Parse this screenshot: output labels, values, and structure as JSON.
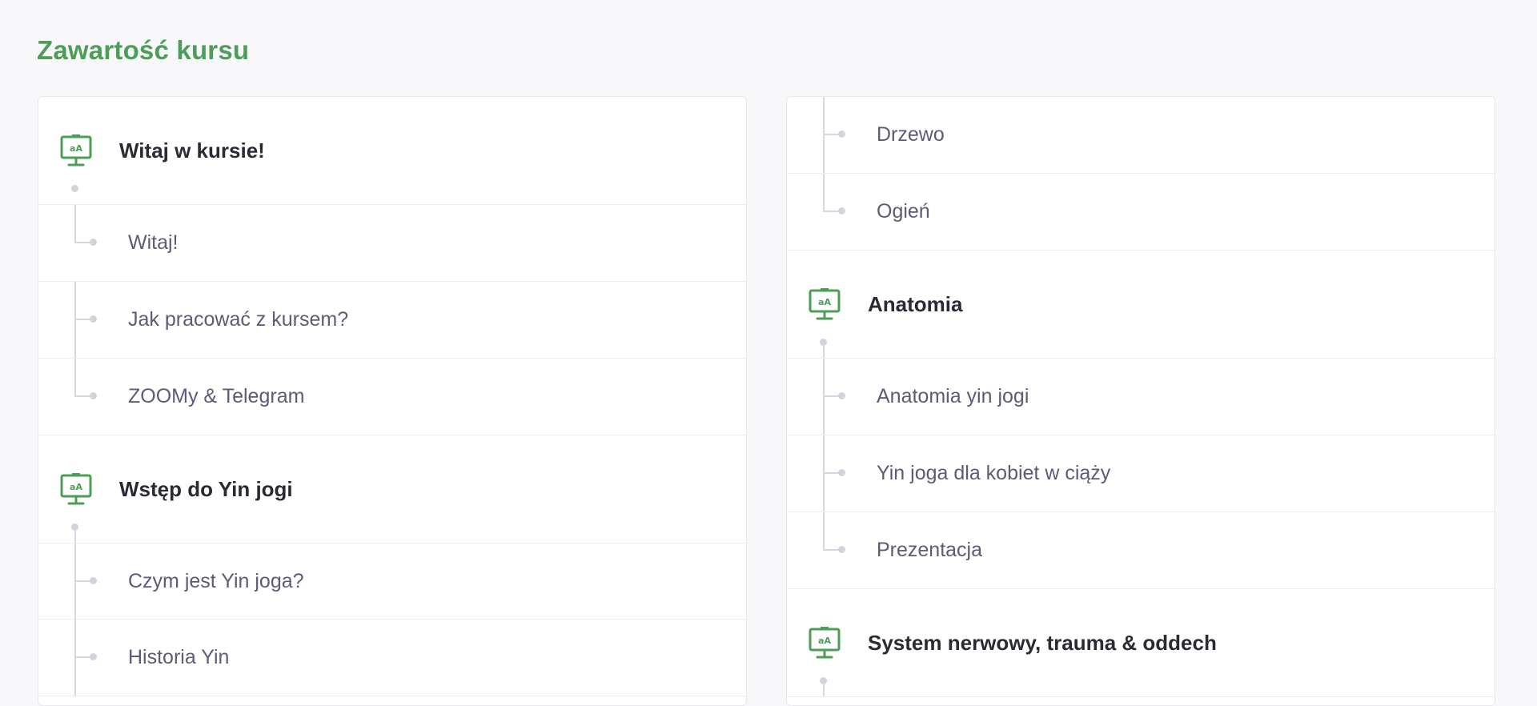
{
  "page": {
    "title": "Zawartość kursu"
  },
  "left_column": {
    "sections": [
      {
        "title": "Witaj w kursie!",
        "lessons": [
          "Witaj!",
          "Jak pracować z kursem?",
          "ZOOMy & Telegram"
        ]
      },
      {
        "title": "Wstęp do Yin jogi",
        "lessons": [
          "Czym jest Yin joga?",
          "Historia Yin"
        ]
      }
    ]
  },
  "right_column": {
    "continued_lessons": [
      "Drzewo",
      "Ogień"
    ],
    "sections": [
      {
        "title": "Anatomia",
        "lessons": [
          "Anatomia yin jogi",
          "Yin joga dla kobiet w ciąży",
          "Prezentacja"
        ]
      },
      {
        "title": "System nerwowy, trauma & oddech",
        "lessons": []
      }
    ]
  },
  "icons": {
    "section_icon": "presentation-board-icon",
    "section_icon_text": "aA"
  },
  "colors": {
    "accent": "#4c9e57",
    "title_text": "#2a2a35",
    "lesson_text": "#5c5b78",
    "tree_line": "#d7d7df"
  }
}
